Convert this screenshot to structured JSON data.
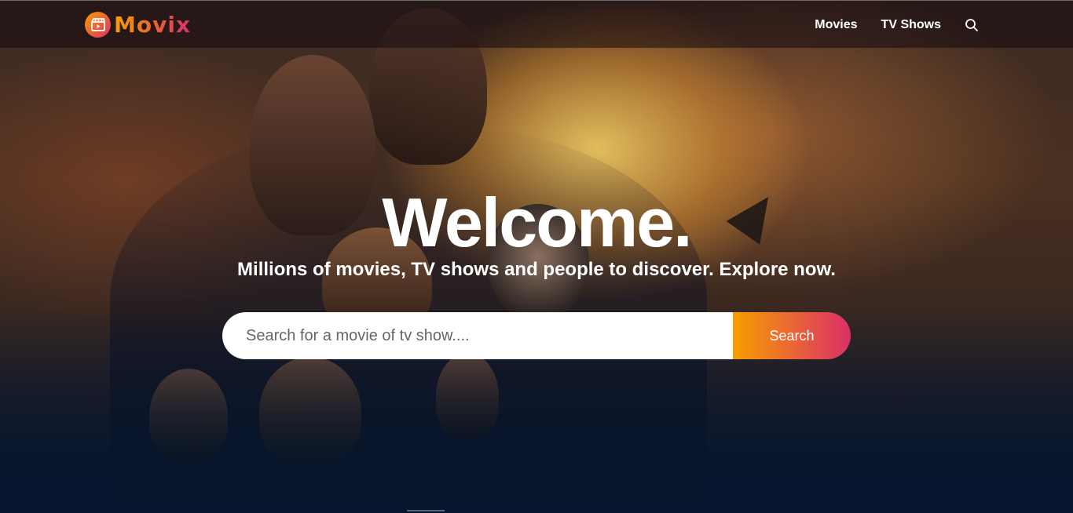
{
  "header": {
    "logo_text": "Movix",
    "nav": [
      {
        "label": "Movies"
      },
      {
        "label": "TV Shows"
      }
    ],
    "search_icon": "search-icon"
  },
  "hero": {
    "title": "Welcome.",
    "subtitle": "Millions of movies, TV shows and people to discover. Explore now.",
    "search": {
      "placeholder": "Search for a movie of tv show....",
      "value": "",
      "button_label": "Search"
    }
  },
  "colors": {
    "accent_start": "#f89e00",
    "accent_end": "#da2f68",
    "background": "#04152d"
  }
}
